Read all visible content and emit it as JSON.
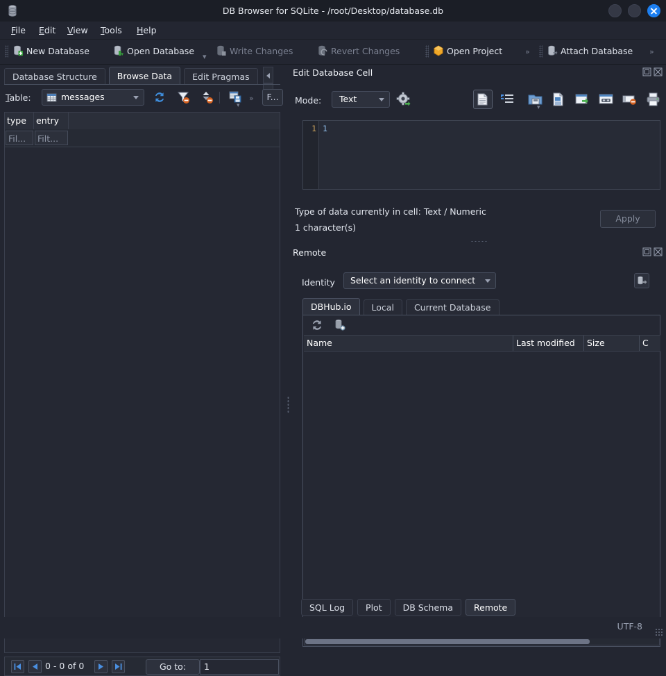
{
  "window": {
    "title": "DB Browser for SQLite - /root/Desktop/database.db",
    "app_icon": "database-icon",
    "buttons": [
      {
        "name": "minimize-button",
        "icon": "minimize-icon"
      },
      {
        "name": "maximize-button",
        "icon": "maximize-icon"
      },
      {
        "name": "close-button",
        "icon": "close-icon"
      }
    ]
  },
  "menubar": {
    "items": [
      {
        "label": "File",
        "mnemonic": "F"
      },
      {
        "label": "Edit",
        "mnemonic": "E"
      },
      {
        "label": "View",
        "mnemonic": "V"
      },
      {
        "label": "Tools",
        "mnemonic": "T"
      },
      {
        "label": "Help",
        "mnemonic": "H"
      }
    ]
  },
  "toolbar": {
    "items": [
      {
        "label": "New Database",
        "icon": "new-database-icon",
        "enabled": true
      },
      {
        "label": "Open Database",
        "icon": "open-database-icon",
        "enabled": true
      },
      {
        "label": "Write Changes",
        "icon": "write-changes-icon",
        "enabled": false
      },
      {
        "label": "Revert Changes",
        "icon": "revert-changes-icon",
        "enabled": false
      },
      {
        "label": "Open Project",
        "icon": "open-project-icon",
        "enabled": true
      },
      {
        "label": "Attach Database",
        "icon": "attach-database-icon",
        "enabled": true
      }
    ]
  },
  "main_tabs": {
    "items": [
      {
        "label": "Database Structure",
        "selected": false
      },
      {
        "label": "Browse Data",
        "selected": true
      },
      {
        "label": "Edit Pragmas",
        "selected": false
      }
    ],
    "scroll_left": "◀",
    "scroll_right": "▶"
  },
  "browse": {
    "table_label": "Table:",
    "table_value": "messages",
    "table_icon": "table-icon",
    "tools": [
      {
        "name": "refresh-button",
        "icon": "refresh-icon"
      },
      {
        "name": "clear-filters-button",
        "icon": "filter-remove-icon"
      },
      {
        "name": "clear-sorting-button",
        "icon": "sort-remove-icon"
      },
      {
        "name": "save-view-button",
        "icon": "save-view-icon"
      }
    ],
    "overflow": "»",
    "find_label": "F...",
    "columns": [
      "type",
      "entry"
    ],
    "filters": [
      "Fil...",
      "Filt..."
    ],
    "rows": [],
    "pager": {
      "first": "first-page-icon",
      "prev": "previous-page-icon",
      "range": "0 - 0 of 0",
      "next": "next-page-icon",
      "last": "last-page-icon",
      "goto_label": "Go to:",
      "goto_value": "1"
    }
  },
  "edit_cell": {
    "title": "Edit Database Cell",
    "float_icon": "float-panel-icon",
    "close_icon": "close-panel-icon",
    "mode_label": "Mode:",
    "mode_value": "Text",
    "settings_icon": "gear-apply-icon",
    "tools": [
      {
        "name": "text-mode-button",
        "icon": "text-document-icon",
        "active": true
      },
      {
        "name": "word-wrap-button",
        "icon": "indent-icon",
        "active": false
      },
      {
        "name": "import-data-button",
        "icon": "import-icon",
        "active": false
      },
      {
        "name": "export-data-button",
        "icon": "export-icon",
        "active": false
      },
      {
        "name": "set-as-null-button",
        "icon": "open-in-app-icon",
        "active": false
      },
      {
        "name": "open-in-external-button",
        "icon": "external-app-icon",
        "active": false
      },
      {
        "name": "clear-cell-button",
        "icon": "clear-cell-icon",
        "active": false
      },
      {
        "name": "print-button",
        "icon": "print-icon",
        "active": false
      }
    ],
    "line_number": "1",
    "content": "1",
    "type_info": "Type of data currently in cell: Text / Numeric",
    "char_info": "1 character(s)",
    "apply_label": "Apply"
  },
  "remote": {
    "title": "Remote",
    "float_icon": "float-panel-icon",
    "close_icon": "close-panel-icon",
    "identity_label": "Identity",
    "identity_value": "Select an identity to connect",
    "connect_icon": "connect-identity-icon",
    "tabs": [
      {
        "label": "DBHub.io",
        "selected": true
      },
      {
        "label": "Local",
        "selected": false
      },
      {
        "label": "Current Database",
        "selected": false
      }
    ],
    "tools": [
      {
        "name": "refresh-remote-button",
        "icon": "refresh-icon"
      },
      {
        "name": "clone-database-button",
        "icon": "clone-database-icon"
      }
    ],
    "columns": [
      "Name",
      "Last modified",
      "Size",
      "C"
    ],
    "rows": []
  },
  "bottom_tabs": {
    "items": [
      {
        "label": "SQL Log",
        "selected": false
      },
      {
        "label": "Plot",
        "selected": false
      },
      {
        "label": "DB Schema",
        "selected": false
      },
      {
        "label": "Remote",
        "selected": true
      }
    ]
  },
  "statusbar": {
    "encoding": "UTF-8"
  },
  "colors": {
    "window_bg": "#232631",
    "titlebar_bg": "#1b1e26",
    "accent": "#1c7ff0",
    "panel_bg": "#252833",
    "tab_selected": "#2d313d",
    "border": "#3a3f4d",
    "text": "#dfe3ea",
    "text_disabled": "#7b8191",
    "gutter_number": "#c8a05c",
    "editor_text": "#8fbce8"
  }
}
